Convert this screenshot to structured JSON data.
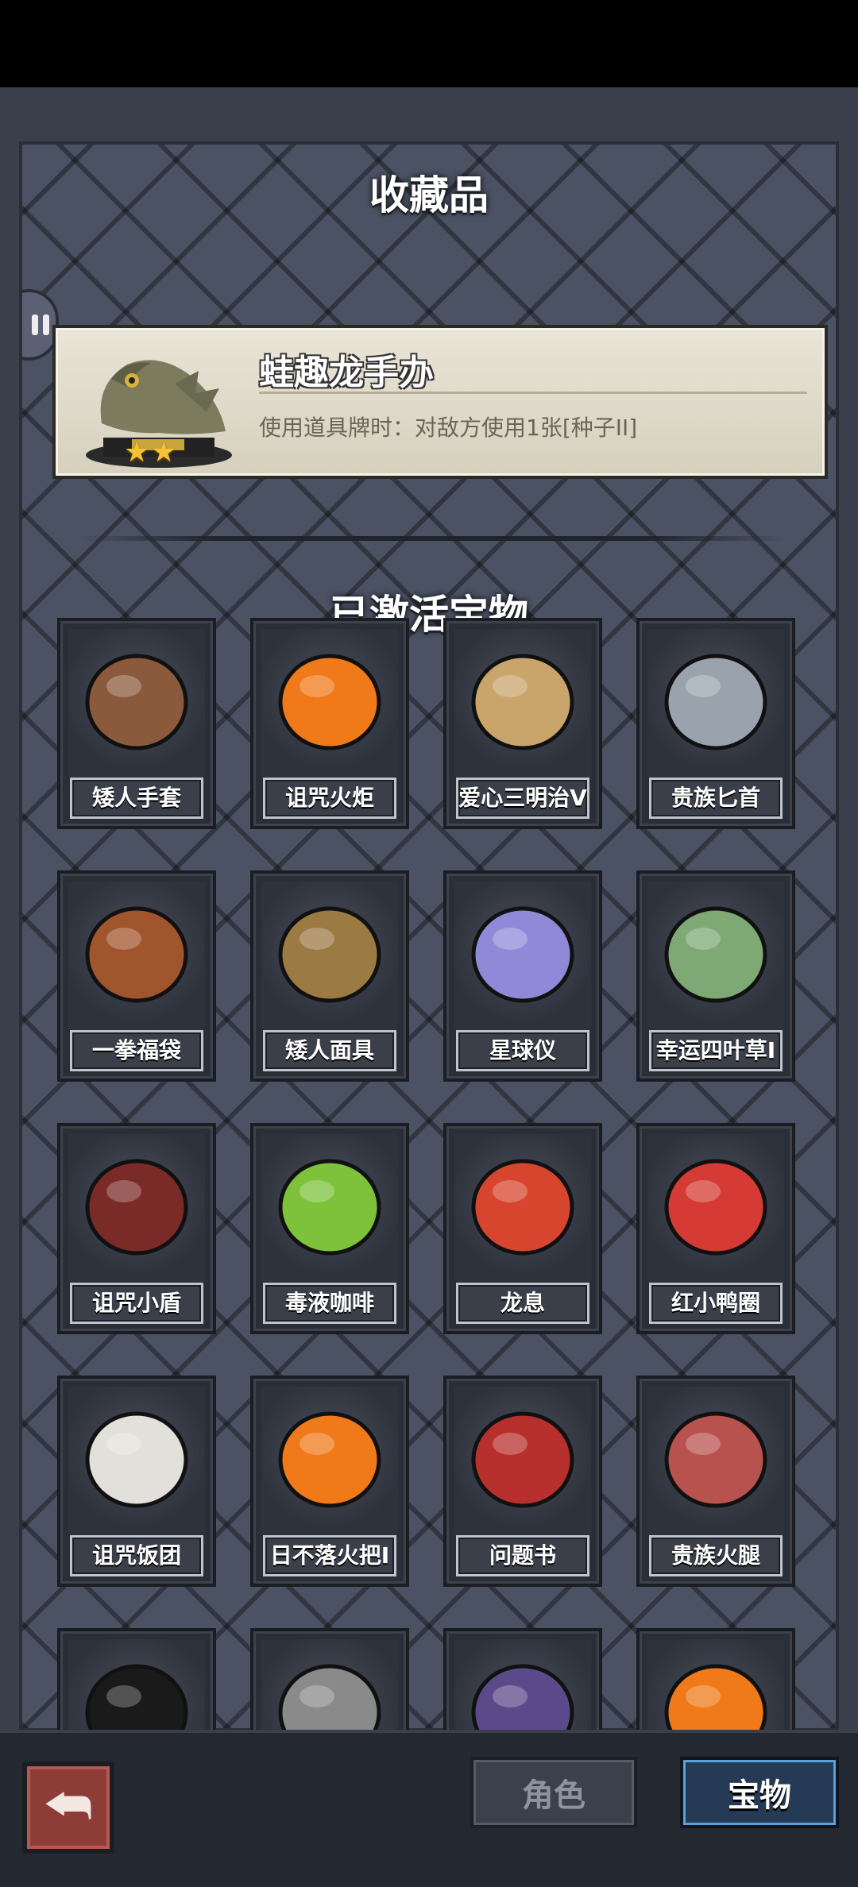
{
  "header": {
    "collection_title": "收藏品",
    "activated_title": "已激活宝物"
  },
  "featured": {
    "name": "蛙趣龙手办",
    "description": "使用道具牌时：对敌方使用1张[种子II]",
    "stars": 2,
    "star_glyph": "★",
    "icon": "frog-dragon-figurine-icon"
  },
  "treasures": [
    {
      "label": "矮人手套",
      "icon": "dwarf-gauntlet-icon",
      "color": "#8b5a3c"
    },
    {
      "label": "诅咒火炬",
      "icon": "cursed-torch-icon",
      "color": "#f07a1a"
    },
    {
      "label": "爱心三明治V",
      "icon": "heart-sandwich-icon",
      "color": "#c9a56c"
    },
    {
      "label": "贵族匕首",
      "icon": "noble-dagger-icon",
      "color": "#9aa3ad"
    },
    {
      "label": "一拳福袋",
      "icon": "fist-lucky-bag-icon",
      "color": "#a0552c"
    },
    {
      "label": "矮人面具",
      "icon": "dwarf-mask-icon",
      "color": "#9c7a44"
    },
    {
      "label": "星球仪",
      "icon": "orrery-icon",
      "color": "#8e8ad8"
    },
    {
      "label": "幸运四叶草I",
      "icon": "four-leaf-clover-icon",
      "color": "#7ea874"
    },
    {
      "label": "诅咒小盾",
      "icon": "cursed-shield-icon",
      "color": "#7a2b28"
    },
    {
      "label": "毒液咖啡",
      "icon": "venom-coffee-icon",
      "color": "#7dc23a"
    },
    {
      "label": "龙息",
      "icon": "dragon-breath-heart-icon",
      "color": "#d8452f"
    },
    {
      "label": "红小鸭圈",
      "icon": "red-duck-ring-icon",
      "color": "#d53a34"
    },
    {
      "label": "诅咒饭团",
      "icon": "cursed-rice-ball-icon",
      "color": "#e2e0da"
    },
    {
      "label": "日不落火把I",
      "icon": "eternal-torch-icon",
      "color": "#f07a1a"
    },
    {
      "label": "问题书",
      "icon": "question-book-icon",
      "color": "#b8302e"
    },
    {
      "label": "贵族火腿",
      "icon": "noble-ham-icon",
      "color": "#b8524e"
    },
    {
      "label": "",
      "icon": "sunglasses-icon",
      "color": "#1a1a1a"
    },
    {
      "label": "",
      "icon": "armor-icon",
      "color": "#8a8a8a"
    },
    {
      "label": "",
      "icon": "spell-book-icon",
      "color": "#5b4a8a"
    },
    {
      "label": "",
      "icon": "fire-log-icon",
      "color": "#f07a1a"
    }
  ],
  "bottom_tabs": {
    "role": "角色",
    "treasure": "宝物"
  },
  "back_glyph": "⮪"
}
